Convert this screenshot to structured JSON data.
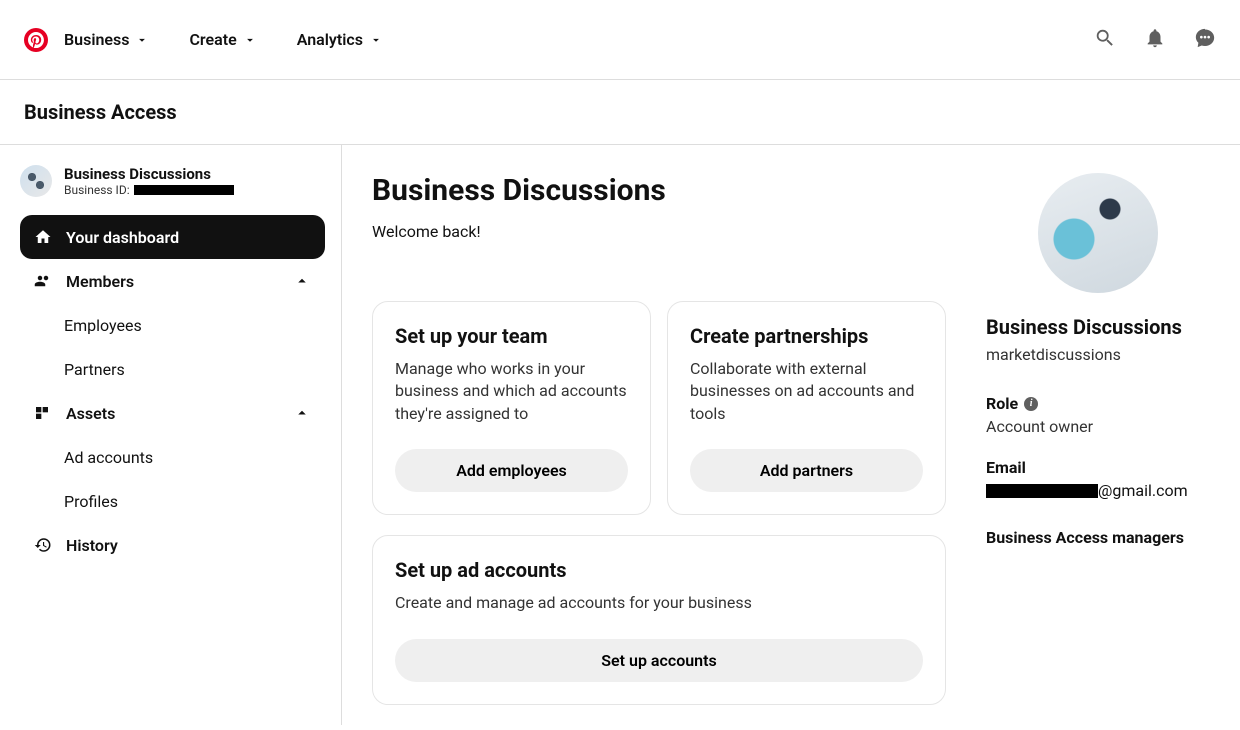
{
  "header": {
    "nav": {
      "business": "Business",
      "create": "Create",
      "analytics": "Analytics"
    }
  },
  "subheader": {
    "title": "Business Access"
  },
  "sidebar": {
    "business_name": "Business Discussions",
    "business_id_label": "Business ID:",
    "items": {
      "dashboard": "Your dashboard",
      "members": "Members",
      "employees": "Employees",
      "partners": "Partners",
      "assets": "Assets",
      "ad_accounts": "Ad accounts",
      "profiles": "Profiles",
      "history": "History"
    }
  },
  "page": {
    "title": "Business Discussions",
    "welcome": "Welcome back!"
  },
  "cards": {
    "team": {
      "title": "Set up your team",
      "desc": "Manage who works in your business and which ad accounts they're assigned to",
      "button": "Add employees"
    },
    "partners": {
      "title": "Create partnerships",
      "desc": "Collaborate with external businesses on ad accounts and tools",
      "button": "Add partners"
    },
    "accounts": {
      "title": "Set up ad accounts",
      "desc": "Create and manage ad accounts for your business",
      "button": "Set up accounts"
    }
  },
  "profile": {
    "name": "Business Discussions",
    "username": "marketdiscussions",
    "role_label": "Role",
    "role_value": "Account owner",
    "email_label": "Email",
    "email_suffix": "@gmail.com",
    "managers": "Business Access managers"
  }
}
